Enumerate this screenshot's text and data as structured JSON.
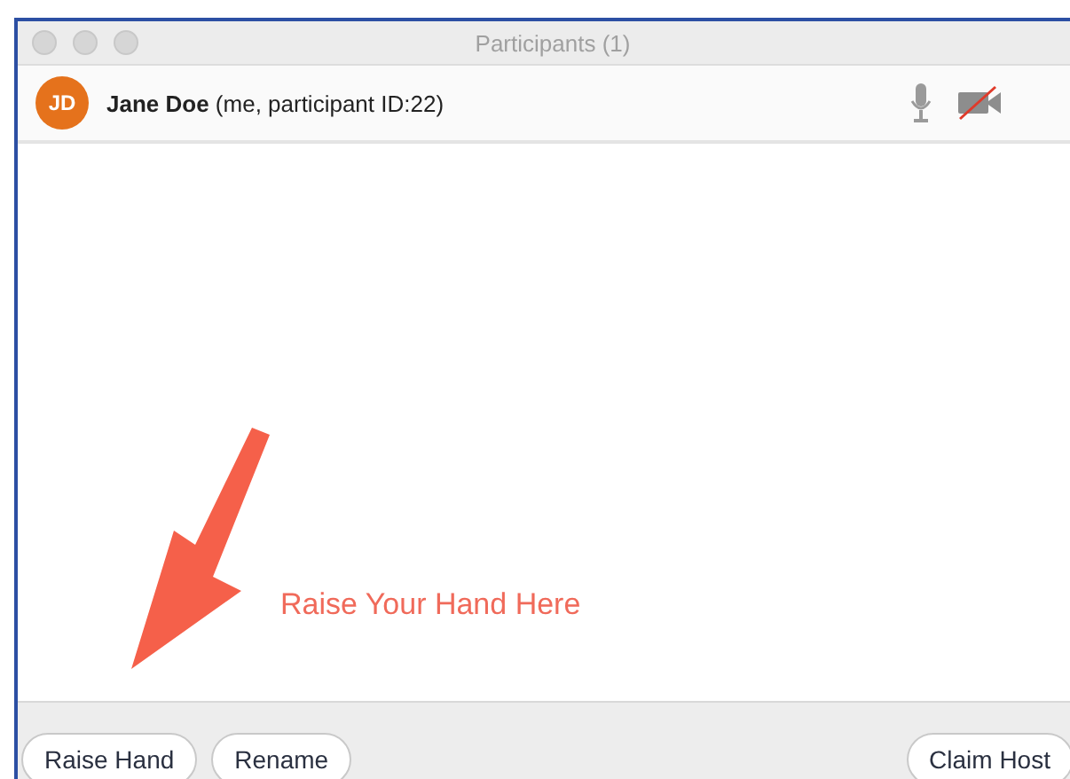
{
  "window": {
    "title": "Participants (1)"
  },
  "participants": [
    {
      "initials": "JD",
      "name": "Jane Doe",
      "detail": "(me, participant ID:22)",
      "mic_muted": false,
      "video_on": false
    }
  ],
  "annotation": {
    "text": "Raise Your Hand Here"
  },
  "buttons_left": [
    "Raise Hand",
    "Rename"
  ],
  "buttons_right": [
    "Claim Host"
  ]
}
